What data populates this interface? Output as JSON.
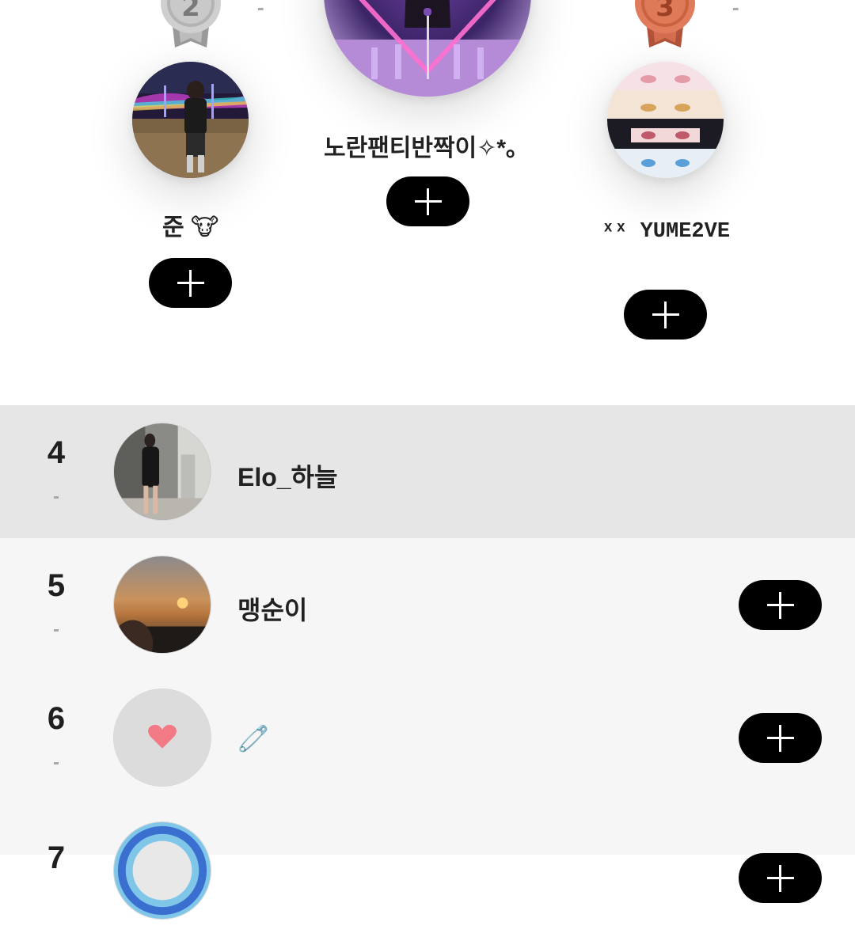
{
  "podium": {
    "second": {
      "rank_dash": "-",
      "name": "준 🐮",
      "medal_icon": "silver-medal-2"
    },
    "first": {
      "name": "노란팬티반짝이✧*｡"
    },
    "third": {
      "rank_dash": "-",
      "name": "ˣˣ YUME2VE",
      "medal_icon": "bronze-medal-3"
    }
  },
  "list": [
    {
      "rank": "4",
      "change": "-",
      "name": "Elo_하늘",
      "highlighted": true,
      "has_add": false
    },
    {
      "rank": "5",
      "change": "-",
      "name": "맹순이",
      "highlighted": false,
      "has_add": true
    },
    {
      "rank": "6",
      "change": "-",
      "name": "🧷",
      "highlighted": false,
      "has_add": true
    },
    {
      "rank": "7",
      "change": "",
      "name": "",
      "highlighted": false,
      "has_add": true
    }
  ],
  "icons": {
    "add": "plus-icon"
  },
  "colors": {
    "button": "#000000",
    "highlight_row": "#e6e6e6",
    "list_bg": "#f6f6f6",
    "muted": "#a9a9a9"
  }
}
